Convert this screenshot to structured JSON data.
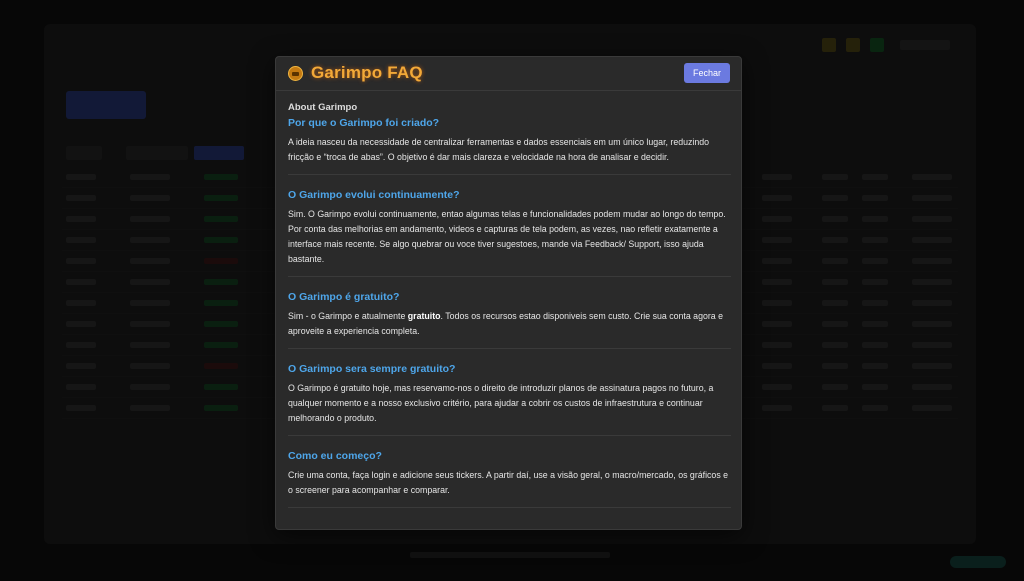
{
  "modal": {
    "title": "Garimpo FAQ",
    "close_label": "Fechar",
    "section_label": "About Garimpo",
    "items": [
      {
        "question": "Por que o Garimpo foi criado?",
        "answer": "A ideia nasceu da necessidade de centralizar ferramentas e dados essenciais em um único lugar, reduzindo fricção e “troca de abas”. O objetivo é dar mais clareza e velocidade na hora de analisar e decidir."
      },
      {
        "question": "O Garimpo evolui continuamente?",
        "answer": "Sim. O Garimpo evolui continuamente, entao algumas telas e funcionalidades podem mudar ao longo do tempo. Por conta das melhorias em andamento, videos e capturas de tela podem, as vezes, nao refletir exatamente a interface mais recente. Se algo quebrar ou voce tiver sugestoes, mande via Feedback/ Support, isso ajuda bastante."
      },
      {
        "question": "O Garimpo é gratuito?",
        "answer_pre": "Sim - o Garimpo e atualmente ",
        "answer_bold": "gratuito",
        "answer_post": ". Todos os recursos estao disponiveis sem custo. Crie sua conta agora e aproveite a experiencia completa."
      },
      {
        "question": "O Garimpo sera sempre gratuito?",
        "answer": "O Garimpo é gratuito hoje, mas reservamo-nos o direito de introduzir planos de assinatura pagos no futuro, a qualquer momento e a nosso exclusivo critério, para ajudar a cobrir os custos de infraestrutura e continuar melhorando o produto."
      },
      {
        "question": "Como eu começo?",
        "answer": "Crie uma conta, faça login e adicione seus tickers. A partir daí, use a visão geral, o macro/mercado, os gráficos e o screener para acompanhar e comparar."
      }
    ]
  },
  "colors": {
    "accent_title": "#f3a938",
    "question": "#4ea6ea",
    "close_button": "#6b7ae0",
    "modal_bg": "#2a2a2a"
  },
  "icons": {
    "logo": "garimpo-logo-icon"
  }
}
